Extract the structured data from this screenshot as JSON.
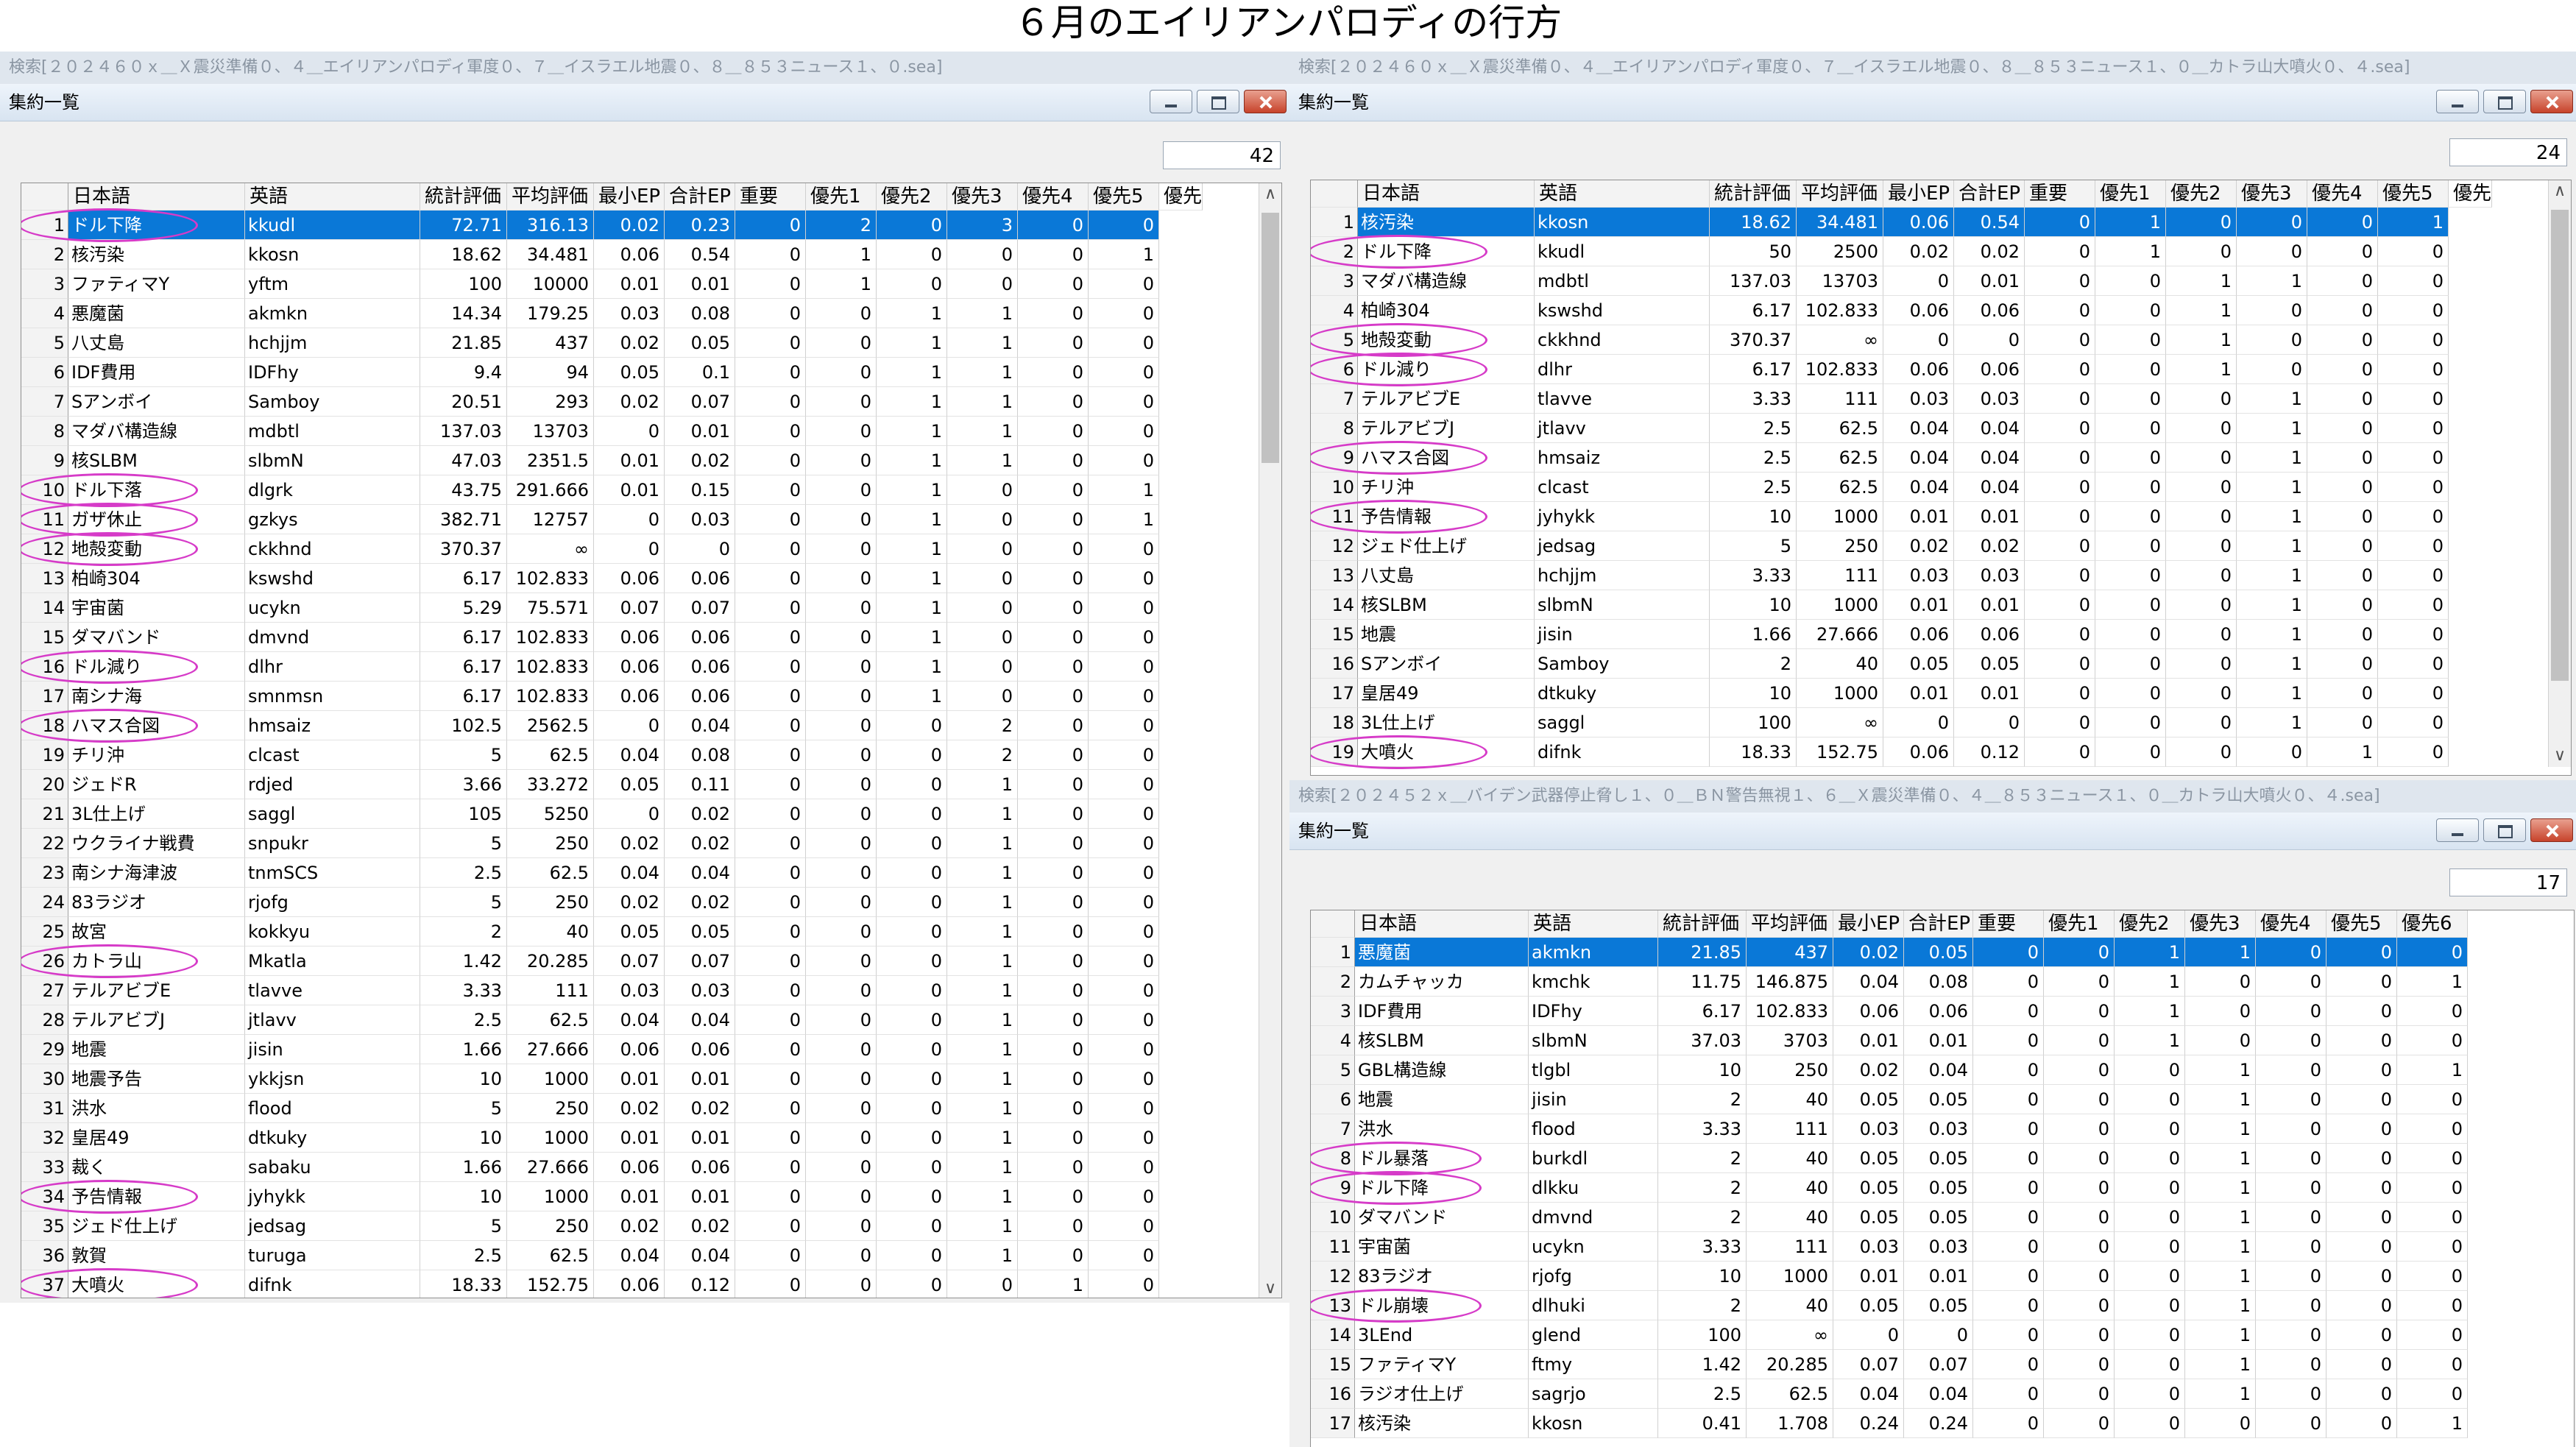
{
  "page_title": "６月のエイリアンパロディの行方",
  "columns": [
    "日本語",
    "英語",
    "統計評価",
    "平均評価",
    "最小EP",
    "合計EP",
    "重要",
    "優先1",
    "優先2",
    "優先3",
    "優先4",
    "優先5",
    "優先",
    "優先6"
  ],
  "panels": {
    "left": {
      "search": "検索[２０２４６０ｘ＿Ｘ震災準備０、４＿エイリアンパロディ軍度０、７＿イスラエル地震０、８＿８５３ニュース１、０.sea]",
      "window_title": "集約一覧",
      "count": "42",
      "rows": [
        [
          "1",
          "ドル下降",
          "kkudl",
          "72.71",
          "316.13",
          "0.02",
          "0.23",
          "0",
          "2",
          "0",
          "3",
          "0",
          "0"
        ],
        [
          "2",
          "核汚染",
          "kkosn",
          "18.62",
          "34.481",
          "0.06",
          "0.54",
          "0",
          "1",
          "0",
          "0",
          "0",
          "1"
        ],
        [
          "3",
          "ファティマY",
          "yftm",
          "100",
          "10000",
          "0.01",
          "0.01",
          "0",
          "1",
          "0",
          "0",
          "0",
          "0"
        ],
        [
          "4",
          "悪魔菌",
          "akmkn",
          "14.34",
          "179.25",
          "0.03",
          "0.08",
          "0",
          "0",
          "1",
          "1",
          "0",
          "0"
        ],
        [
          "5",
          "八丈島",
          "hchjjm",
          "21.85",
          "437",
          "0.02",
          "0.05",
          "0",
          "0",
          "1",
          "1",
          "0",
          "0"
        ],
        [
          "6",
          "IDF費用",
          "IDFhy",
          "9.4",
          "94",
          "0.05",
          "0.1",
          "0",
          "0",
          "1",
          "1",
          "0",
          "0"
        ],
        [
          "7",
          "Sアンボイ",
          "Samboy",
          "20.51",
          "293",
          "0.02",
          "0.07",
          "0",
          "0",
          "1",
          "1",
          "0",
          "0"
        ],
        [
          "8",
          "マダバ構造線",
          "mdbtl",
          "137.03",
          "13703",
          "0",
          "0.01",
          "0",
          "0",
          "1",
          "1",
          "0",
          "0"
        ],
        [
          "9",
          "核SLBM",
          "slbmN",
          "47.03",
          "2351.5",
          "0.01",
          "0.02",
          "0",
          "0",
          "1",
          "1",
          "0",
          "0"
        ],
        [
          "10",
          "ドル下落",
          "dlgrk",
          "43.75",
          "291.666",
          "0.01",
          "0.15",
          "0",
          "0",
          "1",
          "0",
          "0",
          "1"
        ],
        [
          "11",
          "ガザ休止",
          "gzkys",
          "382.71",
          "12757",
          "0",
          "0.03",
          "0",
          "0",
          "1",
          "0",
          "0",
          "1"
        ],
        [
          "12",
          "地殻変動",
          "ckkhnd",
          "370.37",
          "∞",
          "0",
          "0",
          "0",
          "0",
          "1",
          "0",
          "0",
          "0"
        ],
        [
          "13",
          "柏崎304",
          "kswshd",
          "6.17",
          "102.833",
          "0.06",
          "0.06",
          "0",
          "0",
          "1",
          "0",
          "0",
          "0"
        ],
        [
          "14",
          "宇宙菌",
          "ucykn",
          "5.29",
          "75.571",
          "0.07",
          "0.07",
          "0",
          "0",
          "1",
          "0",
          "0",
          "0"
        ],
        [
          "15",
          "ダマバンド",
          "dmvnd",
          "6.17",
          "102.833",
          "0.06",
          "0.06",
          "0",
          "0",
          "1",
          "0",
          "0",
          "0"
        ],
        [
          "16",
          "ドル減り",
          "dlhr",
          "6.17",
          "102.833",
          "0.06",
          "0.06",
          "0",
          "0",
          "1",
          "0",
          "0",
          "0"
        ],
        [
          "17",
          "南シナ海",
          "smnmsn",
          "6.17",
          "102.833",
          "0.06",
          "0.06",
          "0",
          "0",
          "1",
          "0",
          "0",
          "0"
        ],
        [
          "18",
          "ハマス合図",
          "hmsaiz",
          "102.5",
          "2562.5",
          "0",
          "0.04",
          "0",
          "0",
          "0",
          "2",
          "0",
          "0"
        ],
        [
          "19",
          "チリ沖",
          "clcast",
          "5",
          "62.5",
          "0.04",
          "0.08",
          "0",
          "0",
          "0",
          "2",
          "0",
          "0"
        ],
        [
          "20",
          "ジェドR",
          "rdjed",
          "3.66",
          "33.272",
          "0.05",
          "0.11",
          "0",
          "0",
          "0",
          "1",
          "0",
          "0"
        ],
        [
          "21",
          "3L仕上げ",
          "saggl",
          "105",
          "5250",
          "0",
          "0.02",
          "0",
          "0",
          "0",
          "1",
          "0",
          "0"
        ],
        [
          "22",
          "ウクライナ戦費",
          "snpukr",
          "5",
          "250",
          "0.02",
          "0.02",
          "0",
          "0",
          "0",
          "1",
          "0",
          "0"
        ],
        [
          "23",
          "南シナ海津波",
          "tnmSCS",
          "2.5",
          "62.5",
          "0.04",
          "0.04",
          "0",
          "0",
          "0",
          "1",
          "0",
          "0"
        ],
        [
          "24",
          "83ラジオ",
          "rjofg",
          "5",
          "250",
          "0.02",
          "0.02",
          "0",
          "0",
          "0",
          "1",
          "0",
          "0"
        ],
        [
          "25",
          "故宮",
          "kokkyu",
          "2",
          "40",
          "0.05",
          "0.05",
          "0",
          "0",
          "0",
          "1",
          "0",
          "0"
        ],
        [
          "26",
          "カトラ山",
          "Mkatla",
          "1.42",
          "20.285",
          "0.07",
          "0.07",
          "0",
          "0",
          "0",
          "1",
          "0",
          "0"
        ],
        [
          "27",
          "テルアビブE",
          "tlavve",
          "3.33",
          "111",
          "0.03",
          "0.03",
          "0",
          "0",
          "0",
          "1",
          "0",
          "0"
        ],
        [
          "28",
          "テルアビブJ",
          "jtlavv",
          "2.5",
          "62.5",
          "0.04",
          "0.04",
          "0",
          "0",
          "0",
          "1",
          "0",
          "0"
        ],
        [
          "29",
          "地震",
          "jisin",
          "1.66",
          "27.666",
          "0.06",
          "0.06",
          "0",
          "0",
          "0",
          "1",
          "0",
          "0"
        ],
        [
          "30",
          "地震予告",
          "ykkjsn",
          "10",
          "1000",
          "0.01",
          "0.01",
          "0",
          "0",
          "0",
          "1",
          "0",
          "0"
        ],
        [
          "31",
          "洪水",
          "flood",
          "5",
          "250",
          "0.02",
          "0.02",
          "0",
          "0",
          "0",
          "1",
          "0",
          "0"
        ],
        [
          "32",
          "皇居49",
          "dtkuky",
          "10",
          "1000",
          "0.01",
          "0.01",
          "0",
          "0",
          "0",
          "1",
          "0",
          "0"
        ],
        [
          "33",
          "裁く",
          "sabaku",
          "1.66",
          "27.666",
          "0.06",
          "0.06",
          "0",
          "0",
          "0",
          "1",
          "0",
          "0"
        ],
        [
          "34",
          "予告情報",
          "jyhykk",
          "10",
          "1000",
          "0.01",
          "0.01",
          "0",
          "0",
          "0",
          "1",
          "0",
          "0"
        ],
        [
          "35",
          "ジェド仕上げ",
          "jedsag",
          "5",
          "250",
          "0.02",
          "0.02",
          "0",
          "0",
          "0",
          "1",
          "0",
          "0"
        ],
        [
          "36",
          "敦賀",
          "turuga",
          "2.5",
          "62.5",
          "0.04",
          "0.04",
          "0",
          "0",
          "0",
          "1",
          "0",
          "0"
        ],
        [
          "37",
          "大噴火",
          "difnk",
          "18.33",
          "152.75",
          "0.06",
          "0.12",
          "0",
          "0",
          "0",
          "0",
          "1",
          "0"
        ]
      ]
    },
    "top_right": {
      "search": "検索[２０２４６０ｘ＿Ｘ震災準備０、４＿エイリアンパロディ軍度０、７＿イスラエル地震０、８＿８５３ニュース１、０＿カトラ山大噴火０、４.sea]",
      "window_title": "集約一覧",
      "count": "24",
      "rows": [
        [
          "1",
          "核汚染",
          "kkosn",
          "18.62",
          "34.481",
          "0.06",
          "0.54",
          "0",
          "1",
          "0",
          "0",
          "0",
          "1"
        ],
        [
          "2",
          "ドル下降",
          "kkudl",
          "50",
          "2500",
          "0.02",
          "0.02",
          "0",
          "1",
          "0",
          "0",
          "0",
          "0"
        ],
        [
          "3",
          "マダバ構造線",
          "mdbtl",
          "137.03",
          "13703",
          "0",
          "0.01",
          "0",
          "0",
          "1",
          "1",
          "0",
          "0"
        ],
        [
          "4",
          "柏崎304",
          "kswshd",
          "6.17",
          "102.833",
          "0.06",
          "0.06",
          "0",
          "0",
          "1",
          "0",
          "0",
          "0"
        ],
        [
          "5",
          "地殻変動",
          "ckkhnd",
          "370.37",
          "∞",
          "0",
          "0",
          "0",
          "0",
          "1",
          "0",
          "0",
          "0"
        ],
        [
          "6",
          "ドル減り",
          "dlhr",
          "6.17",
          "102.833",
          "0.06",
          "0.06",
          "0",
          "0",
          "1",
          "0",
          "0",
          "0"
        ],
        [
          "7",
          "テルアビブE",
          "tlavve",
          "3.33",
          "111",
          "0.03",
          "0.03",
          "0",
          "0",
          "0",
          "1",
          "0",
          "0"
        ],
        [
          "8",
          "テルアビブJ",
          "jtlavv",
          "2.5",
          "62.5",
          "0.04",
          "0.04",
          "0",
          "0",
          "0",
          "1",
          "0",
          "0"
        ],
        [
          "9",
          "ハマス合図",
          "hmsaiz",
          "2.5",
          "62.5",
          "0.04",
          "0.04",
          "0",
          "0",
          "0",
          "1",
          "0",
          "0"
        ],
        [
          "10",
          "チリ沖",
          "clcast",
          "2.5",
          "62.5",
          "0.04",
          "0.04",
          "0",
          "0",
          "0",
          "1",
          "0",
          "0"
        ],
        [
          "11",
          "予告情報",
          "jyhykk",
          "10",
          "1000",
          "0.01",
          "0.01",
          "0",
          "0",
          "0",
          "1",
          "0",
          "0"
        ],
        [
          "12",
          "ジェド仕上げ",
          "jedsag",
          "5",
          "250",
          "0.02",
          "0.02",
          "0",
          "0",
          "0",
          "1",
          "0",
          "0"
        ],
        [
          "13",
          "八丈島",
          "hchjjm",
          "3.33",
          "111",
          "0.03",
          "0.03",
          "0",
          "0",
          "0",
          "1",
          "0",
          "0"
        ],
        [
          "14",
          "核SLBM",
          "slbmN",
          "10",
          "1000",
          "0.01",
          "0.01",
          "0",
          "0",
          "0",
          "1",
          "0",
          "0"
        ],
        [
          "15",
          "地震",
          "jisin",
          "1.66",
          "27.666",
          "0.06",
          "0.06",
          "0",
          "0",
          "0",
          "1",
          "0",
          "0"
        ],
        [
          "16",
          "Sアンボイ",
          "Samboy",
          "2",
          "40",
          "0.05",
          "0.05",
          "0",
          "0",
          "0",
          "1",
          "0",
          "0"
        ],
        [
          "17",
          "皇居49",
          "dtkuky",
          "10",
          "1000",
          "0.01",
          "0.01",
          "0",
          "0",
          "0",
          "1",
          "0",
          "0"
        ],
        [
          "18",
          "3L仕上げ",
          "saggl",
          "100",
          "∞",
          "0",
          "0",
          "0",
          "0",
          "0",
          "1",
          "0",
          "0"
        ],
        [
          "19",
          "大噴火",
          "difnk",
          "18.33",
          "152.75",
          "0.06",
          "0.12",
          "0",
          "0",
          "0",
          "0",
          "1",
          "0"
        ]
      ]
    },
    "bottom_right": {
      "search": "検索[２０２４５２ｘ＿バイデン武器停止脅し１、０＿ＢＮ警告無視１、６＿Ｘ震災準備０、４＿８５３ニュース１、０＿カトラ山大噴火０、４.sea]",
      "window_title": "集約一覧",
      "count": "17",
      "rows": [
        [
          "1",
          "悪魔菌",
          "akmkn",
          "21.85",
          "437",
          "0.02",
          "0.05",
          "0",
          "0",
          "1",
          "1",
          "0",
          "0",
          "0"
        ],
        [
          "2",
          "カムチャッカ",
          "kmchk",
          "11.75",
          "146.875",
          "0.04",
          "0.08",
          "0",
          "0",
          "1",
          "0",
          "0",
          "0",
          "1"
        ],
        [
          "3",
          "IDF費用",
          "IDFhy",
          "6.17",
          "102.833",
          "0.06",
          "0.06",
          "0",
          "0",
          "1",
          "0",
          "0",
          "0",
          "0"
        ],
        [
          "4",
          "核SLBM",
          "slbmN",
          "37.03",
          "3703",
          "0.01",
          "0.01",
          "0",
          "0",
          "1",
          "0",
          "0",
          "0",
          "0"
        ],
        [
          "5",
          "GBL構造線",
          "tlgbl",
          "10",
          "250",
          "0.02",
          "0.04",
          "0",
          "0",
          "0",
          "1",
          "0",
          "0",
          "1"
        ],
        [
          "6",
          "地震",
          "jisin",
          "2",
          "40",
          "0.05",
          "0.05",
          "0",
          "0",
          "0",
          "1",
          "0",
          "0",
          "0"
        ],
        [
          "7",
          "洪水",
          "flood",
          "3.33",
          "111",
          "0.03",
          "0.03",
          "0",
          "0",
          "0",
          "1",
          "0",
          "0",
          "0"
        ],
        [
          "8",
          "ドル暴落",
          "burkdl",
          "2",
          "40",
          "0.05",
          "0.05",
          "0",
          "0",
          "0",
          "1",
          "0",
          "0",
          "0"
        ],
        [
          "9",
          "ドル下降",
          "dlkku",
          "2",
          "40",
          "0.05",
          "0.05",
          "0",
          "0",
          "0",
          "1",
          "0",
          "0",
          "0"
        ],
        [
          "10",
          "ダマバンド",
          "dmvnd",
          "2",
          "40",
          "0.05",
          "0.05",
          "0",
          "0",
          "0",
          "1",
          "0",
          "0",
          "0"
        ],
        [
          "11",
          "宇宙菌",
          "ucykn",
          "3.33",
          "111",
          "0.03",
          "0.03",
          "0",
          "0",
          "0",
          "1",
          "0",
          "0",
          "0"
        ],
        [
          "12",
          "83ラジオ",
          "rjofg",
          "10",
          "1000",
          "0.01",
          "0.01",
          "0",
          "0",
          "0",
          "1",
          "0",
          "0",
          "0"
        ],
        [
          "13",
          "ドル崩壊",
          "dlhuki",
          "2",
          "40",
          "0.05",
          "0.05",
          "0",
          "0",
          "0",
          "1",
          "0",
          "0",
          "0"
        ],
        [
          "14",
          "3LEnd",
          "glend",
          "100",
          "∞",
          "0",
          "0",
          "0",
          "0",
          "0",
          "1",
          "0",
          "0",
          "0"
        ],
        [
          "15",
          "ファティマY",
          "ftmy",
          "1.42",
          "20.285",
          "0.07",
          "0.07",
          "0",
          "0",
          "0",
          "1",
          "0",
          "0",
          "0"
        ],
        [
          "16",
          "ラジオ仕上げ",
          "sagrjo",
          "2.5",
          "62.5",
          "0.04",
          "0.04",
          "0",
          "0",
          "0",
          "1",
          "0",
          "0",
          "0"
        ],
        [
          "17",
          "核汚染",
          "kkosn",
          "0.41",
          "1.708",
          "0.24",
          "0.24",
          "0",
          "0",
          "0",
          "0",
          "0",
          "0",
          "1"
        ]
      ]
    }
  },
  "highlights": {
    "left": [
      "1",
      "10",
      "11",
      "12",
      "16",
      "18",
      "26",
      "34",
      "37"
    ],
    "top_right": [
      "2",
      "5",
      "6",
      "9",
      "11",
      "19"
    ],
    "bottom_right": [
      "8",
      "9",
      "13"
    ]
  },
  "colors": {
    "selection": "#0a78d7",
    "highlight_ellipse": "#d63bc8"
  }
}
